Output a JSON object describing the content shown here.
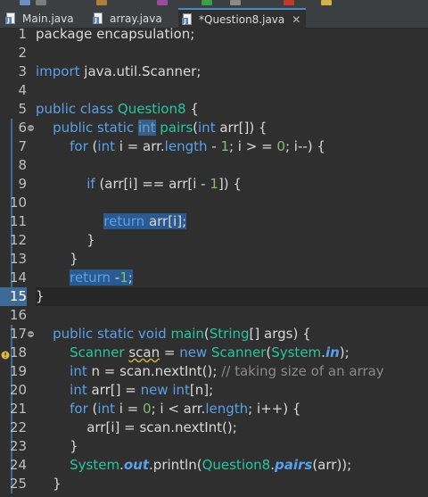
{
  "tabs": [
    {
      "label": "Main.java",
      "active": false
    },
    {
      "label": "array.java",
      "active": false
    },
    {
      "label": "*Question8.java",
      "active": true,
      "close": "✕"
    }
  ],
  "lines": [
    {
      "n": "1",
      "tokens": [
        {
          "t": "package encapsulation;",
          "c": ""
        }
      ]
    },
    {
      "n": "2",
      "tokens": []
    },
    {
      "n": "3",
      "tokens": [
        {
          "t": "import ",
          "c": "kw"
        },
        {
          "t": "java.util.Scanner;",
          "c": ""
        }
      ]
    },
    {
      "n": "4",
      "tokens": []
    },
    {
      "n": "5",
      "tokens": [
        {
          "t": "public class ",
          "c": "kw"
        },
        {
          "t": "Question8",
          "c": "cls"
        },
        {
          "t": " {",
          "c": ""
        }
      ]
    },
    {
      "n": "6",
      "tokens": [
        {
          "t": "    public static ",
          "c": "kw"
        },
        {
          "t": "int",
          "c": "kw hl"
        },
        {
          "t": " ",
          "c": ""
        },
        {
          "t": "pairs",
          "c": "fn"
        },
        {
          "t": "(",
          "c": ""
        },
        {
          "t": "int",
          "c": "kw"
        },
        {
          "t": " arr[]) {",
          "c": ""
        }
      ]
    },
    {
      "n": "7",
      "tokens": [
        {
          "t": "        ",
          "c": ""
        },
        {
          "t": "for",
          "c": "kw"
        },
        {
          "t": " (",
          "c": ""
        },
        {
          "t": "int",
          "c": "kw"
        },
        {
          "t": " i = arr.",
          "c": ""
        },
        {
          "t": "length",
          "c": "kw"
        },
        {
          "t": " - ",
          "c": ""
        },
        {
          "t": "1",
          "c": "num"
        },
        {
          "t": "; i > = ",
          "c": ""
        },
        {
          "t": "0",
          "c": "num"
        },
        {
          "t": "; i--) {",
          "c": ""
        }
      ]
    },
    {
      "n": "8",
      "tokens": []
    },
    {
      "n": "9",
      "tokens": [
        {
          "t": "            ",
          "c": ""
        },
        {
          "t": "if",
          "c": "kw"
        },
        {
          "t": " (arr[i] == arr[i - ",
          "c": ""
        },
        {
          "t": "1",
          "c": "num"
        },
        {
          "t": "]) {",
          "c": ""
        }
      ]
    },
    {
      "n": "10",
      "tokens": []
    },
    {
      "n": "11",
      "tokens": [
        {
          "t": "                ",
          "c": ""
        },
        {
          "t": "return",
          "c": "kw sel"
        },
        {
          "t": " arr[i];",
          "c": "sel"
        }
      ]
    },
    {
      "n": "12",
      "tokens": [
        {
          "t": "            }",
          "c": ""
        }
      ]
    },
    {
      "n": "13",
      "tokens": [
        {
          "t": "        }",
          "c": ""
        }
      ]
    },
    {
      "n": "14",
      "tokens": [
        {
          "t": "        ",
          "c": ""
        },
        {
          "t": "return",
          "c": "kw sel"
        },
        {
          "t": " -",
          "c": "sel"
        },
        {
          "t": "1",
          "c": "num sel"
        },
        {
          "t": ";",
          "c": "sel"
        }
      ]
    },
    {
      "n": "15",
      "tokens": [
        {
          "t": "}",
          "c": ""
        }
      ]
    },
    {
      "n": "16",
      "tokens": []
    },
    {
      "n": "17",
      "tokens": [
        {
          "t": "    public static void ",
          "c": "kw"
        },
        {
          "t": "main",
          "c": "fn"
        },
        {
          "t": "(",
          "c": ""
        },
        {
          "t": "String",
          "c": "cls"
        },
        {
          "t": "[] args) {",
          "c": ""
        }
      ]
    },
    {
      "n": "18",
      "tokens": [
        {
          "t": "        ",
          "c": ""
        },
        {
          "t": "Scanner",
          "c": "cls"
        },
        {
          "t": " ",
          "c": ""
        },
        {
          "t": "scan",
          "c": "warnul"
        },
        {
          "t": " = ",
          "c": ""
        },
        {
          "t": "new",
          "c": "kw"
        },
        {
          "t": " ",
          "c": ""
        },
        {
          "t": "Scanner",
          "c": "cls"
        },
        {
          "t": "(",
          "c": ""
        },
        {
          "t": "System",
          "c": "cls"
        },
        {
          "t": ".",
          "c": ""
        },
        {
          "t": "in",
          "c": "fld"
        },
        {
          "t": ");",
          "c": ""
        }
      ]
    },
    {
      "n": "19",
      "tokens": [
        {
          "t": "        ",
          "c": ""
        },
        {
          "t": "int",
          "c": "kw"
        },
        {
          "t": " n = scan.nextInt(); ",
          "c": ""
        },
        {
          "t": "// taking size of an array",
          "c": "cm"
        }
      ]
    },
    {
      "n": "20",
      "tokens": [
        {
          "t": "        ",
          "c": ""
        },
        {
          "t": "int",
          "c": "kw"
        },
        {
          "t": " arr[] = ",
          "c": ""
        },
        {
          "t": "new",
          "c": "kw"
        },
        {
          "t": " ",
          "c": ""
        },
        {
          "t": "int",
          "c": "kw"
        },
        {
          "t": "[n];",
          "c": ""
        }
      ]
    },
    {
      "n": "21",
      "tokens": [
        {
          "t": "        ",
          "c": ""
        },
        {
          "t": "for",
          "c": "kw"
        },
        {
          "t": " (",
          "c": ""
        },
        {
          "t": "int",
          "c": "kw"
        },
        {
          "t": " i = ",
          "c": ""
        },
        {
          "t": "0",
          "c": "num"
        },
        {
          "t": "; i < arr.",
          "c": ""
        },
        {
          "t": "length",
          "c": "kw"
        },
        {
          "t": "; i++) {",
          "c": ""
        }
      ]
    },
    {
      "n": "22",
      "tokens": [
        {
          "t": "            arr[i] = scan.nextInt();",
          "c": ""
        }
      ]
    },
    {
      "n": "23",
      "tokens": [
        {
          "t": "        }",
          "c": ""
        }
      ]
    },
    {
      "n": "24",
      "tokens": [
        {
          "t": "        ",
          "c": ""
        },
        {
          "t": "System",
          "c": "cls"
        },
        {
          "t": ".",
          "c": ""
        },
        {
          "t": "out",
          "c": "fld"
        },
        {
          "t": ".println(",
          "c": ""
        },
        {
          "t": "Question8",
          "c": "cls"
        },
        {
          "t": ".",
          "c": ""
        },
        {
          "t": "pairs",
          "c": "fld"
        },
        {
          "t": "(arr));",
          "c": ""
        }
      ]
    },
    {
      "n": "25",
      "tokens": [
        {
          "t": "    }",
          "c": ""
        }
      ]
    }
  ],
  "colors": {
    "background": "#2f2f2f",
    "keyword": "#5aa0e8",
    "type": "#28c6a0",
    "number": "#7fbf6a",
    "comment": "#8a8a8a",
    "selection": "#2a5a8f"
  }
}
